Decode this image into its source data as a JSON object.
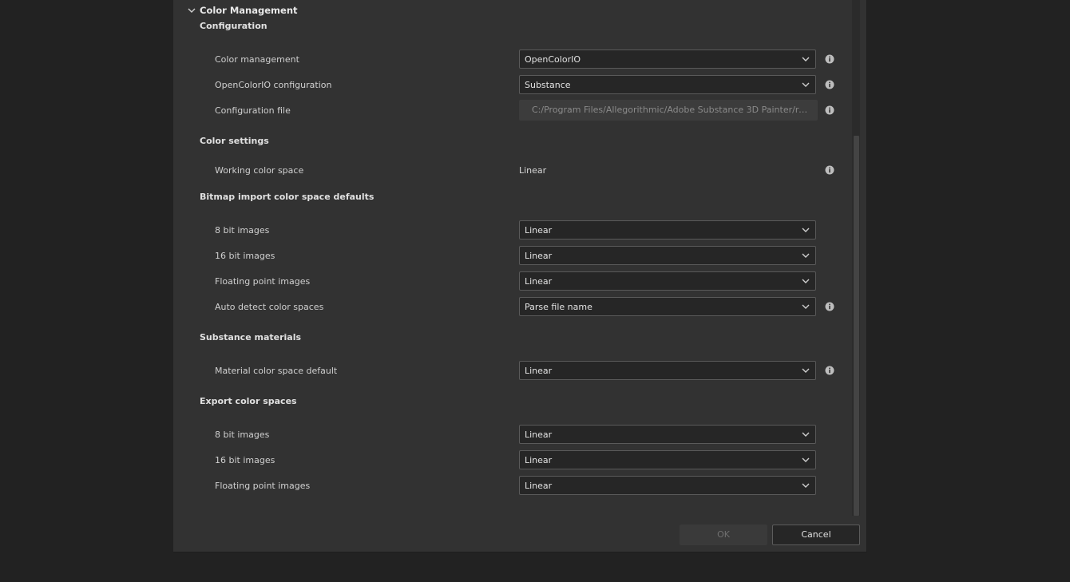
{
  "header": {
    "title": "Color Management"
  },
  "configuration": {
    "title": "Configuration",
    "rows": {
      "color_management": {
        "label": "Color management",
        "value": "OpenColorIO"
      },
      "ocio_config": {
        "label": "OpenColorIO configuration",
        "value": "Substance"
      },
      "config_file": {
        "label": "Configuration file",
        "value": "C:/Program Files/Allegorithmic/Adobe Substance 3D Painter/resource..."
      }
    }
  },
  "color_settings": {
    "title": "Color settings",
    "working_space": {
      "label": "Working color space",
      "value": "Linear"
    }
  },
  "bitmap_import": {
    "title": "Bitmap import color space defaults",
    "rows": {
      "bit8": {
        "label": "8 bit images",
        "value": "Linear"
      },
      "bit16": {
        "label": "16 bit images",
        "value": "Linear"
      },
      "float": {
        "label": "Floating point images",
        "value": "Linear"
      },
      "auto": {
        "label": "Auto detect color spaces",
        "value": "Parse file name"
      }
    }
  },
  "substance_materials": {
    "title": "Substance materials",
    "material_default": {
      "label": "Material color space default",
      "value": "Linear"
    }
  },
  "export": {
    "title": "Export color spaces",
    "rows": {
      "bit8": {
        "label": "8 bit images",
        "value": "Linear"
      },
      "bit16": {
        "label": "16 bit images",
        "value": "Linear"
      },
      "float": {
        "label": "Floating point images",
        "value": "Linear"
      }
    }
  },
  "footer": {
    "ok_label": "OK",
    "cancel_label": "Cancel"
  },
  "icons": {
    "chevron": "chevron-down-icon",
    "info": "info-icon",
    "collapse": "collapse-arrow-icon"
  },
  "colors": {
    "background": "#222222",
    "panel": "#323232",
    "field": "#262626",
    "border": "#5a5a5a"
  }
}
